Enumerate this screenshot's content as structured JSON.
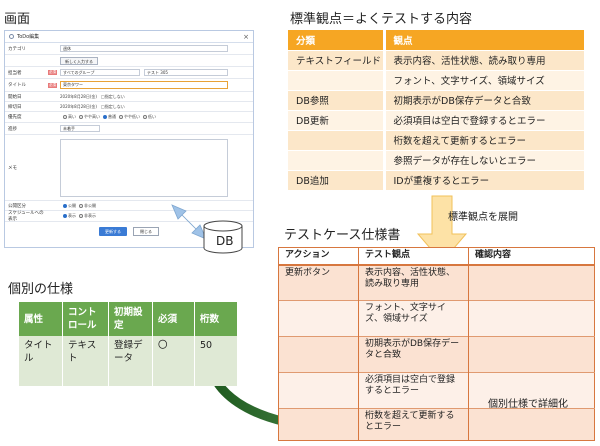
{
  "screen_section": {
    "title": "画面",
    "window_title": "ToDo編集",
    "fields": [
      {
        "label": "カテゴリ",
        "required": false,
        "value": "週休"
      },
      {
        "label": "",
        "required": false,
        "button": "新しく入力する"
      },
      {
        "label": "担当者",
        "required": true,
        "value": "すべてのグループ",
        "value2": "テスト 305"
      },
      {
        "label": "タイトル",
        "required": true,
        "value": "東京タワー"
      },
      {
        "label": "開始日",
        "required": false,
        "value": "2020年8月28日(金)",
        "extra": "指定しない"
      },
      {
        "label": "締切日",
        "required": false,
        "value": "2020年8月28日(金)",
        "extra": "指定しない"
      },
      {
        "label": "優先度",
        "required": false,
        "options": [
          "高い",
          "やや高い",
          "普通",
          "やや低い",
          "低い"
        ]
      },
      {
        "label": "進捗",
        "required": false,
        "value": "未着手"
      },
      {
        "label": "メモ",
        "required": false
      },
      {
        "label": "公開区分",
        "required": false,
        "options": [
          "公開",
          "非公開"
        ]
      },
      {
        "label": "スケジュールへの表示",
        "required": false,
        "options": [
          "表示",
          "非表示"
        ]
      }
    ],
    "save_button": "更新する",
    "cancel_button": "閉じる"
  },
  "db_label": "DB",
  "standard_section": {
    "title": "標準観点＝よくテストする内容",
    "headers": [
      "分類",
      "観点"
    ],
    "rows": [
      [
        "テキストフィールド",
        "表示内容、活性状態、読み取り専用"
      ],
      [
        "",
        "フォント、文字サイズ、領域サイズ"
      ],
      [
        "DB参照",
        "初期表示がDB保存データと合致"
      ],
      [
        "DB更新",
        "必須項目は空白で登録するとエラー"
      ],
      [
        "",
        "桁数を超えて更新するとエラー"
      ],
      [
        "",
        "参照データが存在しないとエラー"
      ],
      [
        "DB追加",
        "IDが重複するとエラー"
      ]
    ]
  },
  "expand_note": "標準観点を展開",
  "testcase_section": {
    "title": "テストケース仕様書",
    "headers": [
      "アクション",
      "テスト観点",
      "確認内容"
    ],
    "rows": [
      [
        "更新ボタン",
        "表示内容、活性状態、読み取り専用",
        ""
      ],
      [
        "",
        "フォント、文字サイズ、領域サイズ",
        ""
      ],
      [
        "",
        "初期表示がDB保存データと合致",
        ""
      ],
      [
        "",
        "必須項目は空白で登録するとエラー",
        ""
      ],
      [
        "",
        "桁数を超えて更新するとエラー",
        ""
      ]
    ]
  },
  "individual_section": {
    "title": "個別の仕様",
    "headers": [
      "属性",
      "コントロール",
      "初期設定",
      "必須",
      "桁数"
    ],
    "rows": [
      [
        "タイトル",
        "テキスト",
        "登録データ",
        "〇",
        "50"
      ]
    ]
  },
  "detail_note": "個別仕様で詳細化",
  "colors": {
    "orange": "#f6a623",
    "green": "#6aa84f",
    "testcase_border": "#d7773f",
    "arrow_blue": "#9fc2e7"
  }
}
